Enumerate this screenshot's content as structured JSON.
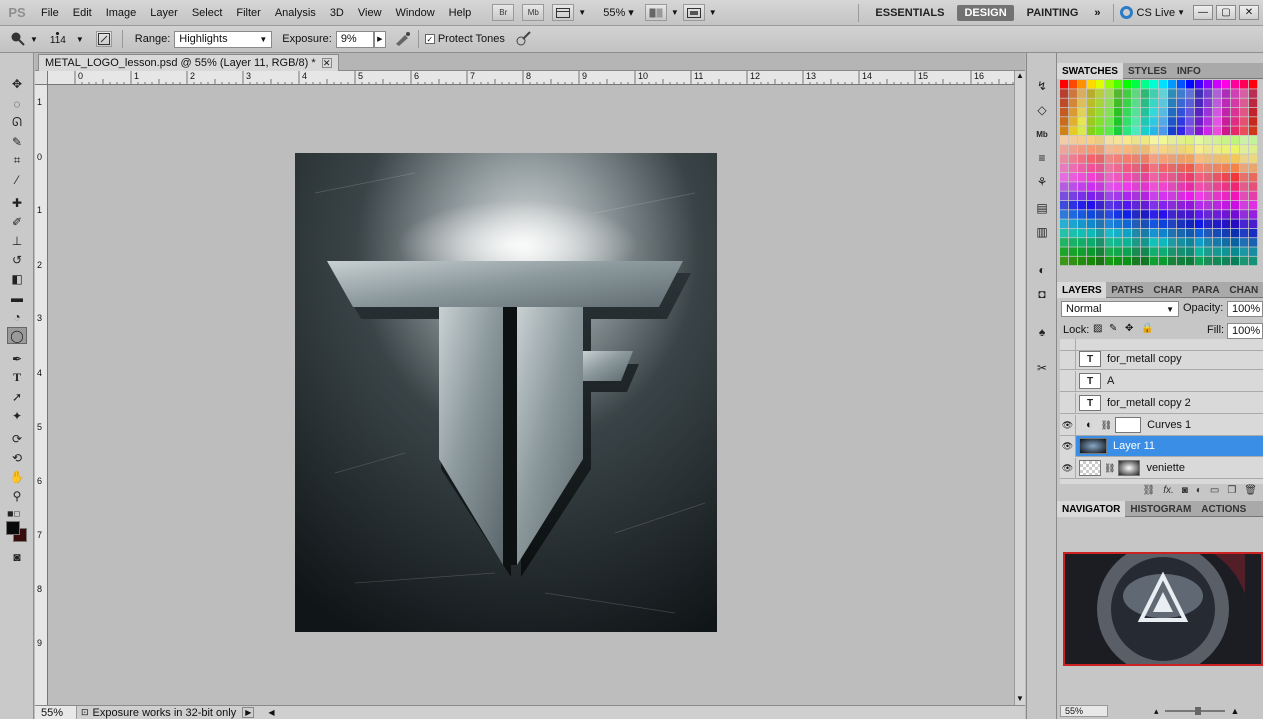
{
  "menubar": {
    "app_logo": "PS",
    "menus": [
      "File",
      "Edit",
      "Image",
      "Layer",
      "Select",
      "Filter",
      "Analysis",
      "3D",
      "View",
      "Window",
      "Help"
    ],
    "bridge_label": "Br",
    "minibridge_label": "Mb",
    "zoom_value": "55%",
    "workspaces": [
      "ESSENTIALS",
      "DESIGN",
      "PAINTING"
    ],
    "active_workspace": "DESIGN",
    "cs_live": "CS Live"
  },
  "options": {
    "brush_size": "114",
    "range_label": "Range:",
    "range_value": "Highlights",
    "exposure_label": "Exposure:",
    "exposure_value": "9%",
    "protect_tones_label": "Protect Tones",
    "protect_tones_checked": true
  },
  "document": {
    "tab_title": "METAL_LOGO_lesson.psd @ 55% (Layer 11, RGB/8) *",
    "ruler_top": [
      "0",
      "1",
      "2",
      "3",
      "4",
      "5",
      "6",
      "7",
      "8",
      "9",
      "10",
      "11",
      "12",
      "13",
      "14",
      "15",
      "16"
    ],
    "ruler_left": [
      "1",
      "0",
      "1",
      "2",
      "3",
      "4",
      "5",
      "6",
      "7",
      "8",
      "9"
    ],
    "status_zoom": "55%",
    "status_text": "Exposure works in 32-bit only"
  },
  "panels": {
    "swatch_tabs": [
      "SWATCHES",
      "STYLES",
      "INFO"
    ],
    "layer_tabs": [
      "LAYERS",
      "PATHS",
      "CHAR",
      "PARA",
      "CHAN"
    ],
    "blend_mode": "Normal",
    "opacity_label": "Opacity:",
    "opacity_value": "100%",
    "lock_label": "Lock:",
    "fill_label": "Fill:",
    "fill_value": "100%",
    "layers": [
      {
        "name": "for_metall copy",
        "kind": "text",
        "visible": false,
        "selected": false
      },
      {
        "name": "A",
        "kind": "text",
        "visible": false,
        "selected": false
      },
      {
        "name": "for_metall copy 2",
        "kind": "text",
        "visible": false,
        "selected": false
      },
      {
        "name": "Curves 1",
        "kind": "adjustment",
        "visible": true,
        "selected": false
      },
      {
        "name": "Layer 11",
        "kind": "image",
        "visible": true,
        "selected": true
      },
      {
        "name": "veniette",
        "kind": "masked",
        "visible": true,
        "selected": false
      }
    ],
    "navigator_tabs": [
      "NAVIGATOR",
      "HISTOGRAM",
      "ACTIONS"
    ],
    "navigator_zoom": "55%"
  }
}
